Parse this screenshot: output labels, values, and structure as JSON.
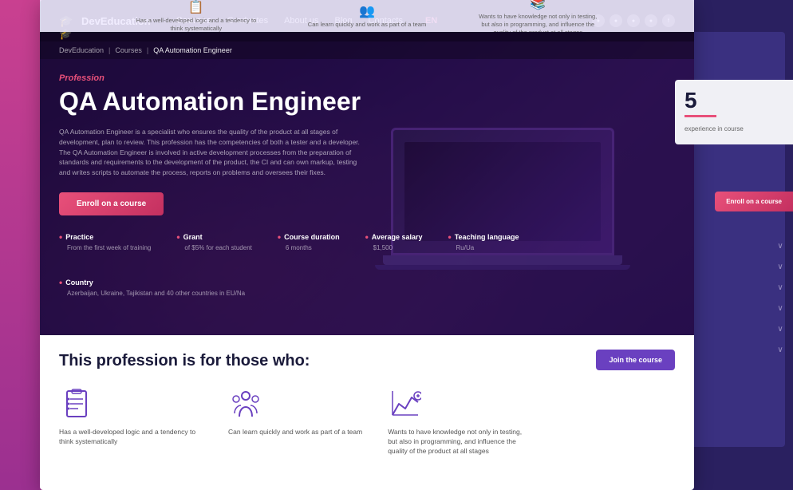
{
  "brand": {
    "logo_text": "DevEducation",
    "logo_icon": "🎓"
  },
  "navbar": {
    "links": [
      "Courses",
      "Graduates",
      "About us",
      "Blog",
      "Contacts"
    ],
    "lang": "EN",
    "active_link": "Courses"
  },
  "breadcrumb": {
    "items": [
      "DevEducation",
      "Courses",
      "QA Automation Engineer"
    ],
    "separator": "|"
  },
  "hero": {
    "profession_label": "Profession",
    "title": "QA Automation Engineer",
    "description": "QA Automation Engineer is a specialist who ensures the quality of the product at all stages of development, plan to review. This profession has the competencies of both a tester and a developer. The QA Automation Engineer is involved in active development processes from the preparation of standards and requirements to the development of the product, the CI and can own markup, testing and writes scripts to automate the process, reports on problems and oversees their fixes.",
    "enroll_label": "Enroll on a course"
  },
  "stats": [
    {
      "label": "Practice",
      "value": "From the first week of training"
    },
    {
      "label": "Grant",
      "value": "of $5% for each student"
    },
    {
      "label": "Course duration",
      "value": "6 months"
    },
    {
      "label": "Average salary",
      "value": "$1,500"
    },
    {
      "label": "Teaching language",
      "value": "Ru/Ua"
    },
    {
      "label": "Country",
      "value": "Azerbaijan, Ukraine, Tajikistan and 40 other countries in EU/Na"
    }
  ],
  "sidebar": {
    "counter": "5",
    "counter_bar_color": "#e8507a",
    "counter_text": "experience in course",
    "enroll_label": "Enroll on a course"
  },
  "white_section": {
    "title": "This profession is for those who:",
    "join_label": "Join the course",
    "cards": [
      {
        "icon": "clipboard-list",
        "text": "Has a well-developed logic and a tendency to think systematically"
      },
      {
        "icon": "people-group",
        "text": "Can learn quickly and work as part of a team"
      },
      {
        "icon": "mountain-chart",
        "text": "Wants to have knowledge not only in testing, but also in programming, and influence the quality of the product at all stages"
      }
    ]
  },
  "top_strip": {
    "items": [
      {
        "icon": "📋",
        "text": "Has a well-developed logic and a tendency to think systematically"
      },
      {
        "icon": "👥",
        "text": "Can learn quickly and work as part of a team"
      },
      {
        "icon": "📊",
        "text": "Wants to have knowledge not only in testing, but also in programming, and influence the quality of the product at all stages"
      }
    ]
  },
  "chevrons": [
    "›",
    "›",
    "›",
    "›",
    "›",
    "›"
  ]
}
